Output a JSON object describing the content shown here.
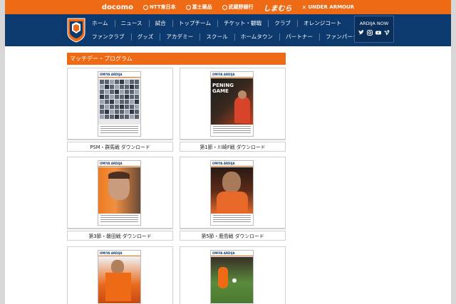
{
  "sponsors": [
    "docomo",
    "NTT東日本",
    "富士薬品",
    "武蔵野銀行",
    "しまむら",
    "UNDER ARMOUR"
  ],
  "nav": {
    "row1": [
      "ホーム",
      "ニュース",
      "試合",
      "トップチーム",
      "チケット・観戦",
      "クラブ",
      "オレンジコート"
    ],
    "row2": [
      "ファンクラブ",
      "グッズ",
      "アカデミー",
      "スクール",
      "ホームタウン",
      "パートナー",
      "ファンパーク"
    ],
    "ardija_now": "ARDIJA NOW",
    "social_icons": [
      "twitter-icon",
      "instagram-icon",
      "youtube-icon",
      "vimeo-icon"
    ]
  },
  "section": {
    "title": "マッチデー・プログラム"
  },
  "programs": [
    {
      "caption": "PSM・群馬戦 ダウンロード",
      "masthead": "OMIYA ARDIJA",
      "style": "grid"
    },
    {
      "caption": "第1節・川崎F戦 ダウンロード",
      "masthead": "OMIYA ARDIJA",
      "cover_text": "PENING GAME",
      "style": "dark-red"
    },
    {
      "caption": "第3節・磐田戦 ダウンロード",
      "masthead": "OMIYA ARDIJA",
      "style": "orange-face"
    },
    {
      "caption": "第5節・鹿島戦 ダウンロード",
      "masthead": "OMIYA ARDIJA",
      "style": "dark-orange"
    },
    {
      "caption": "",
      "masthead": "OMIYA ARDIJA",
      "style": "orange-player"
    },
    {
      "caption": "",
      "masthead": "OMIYA ARDIJA",
      "style": "green-action"
    }
  ],
  "colors": {
    "accent_orange": "#ee6a14",
    "navy": "#0c3a6e",
    "background": "#ffffff"
  }
}
